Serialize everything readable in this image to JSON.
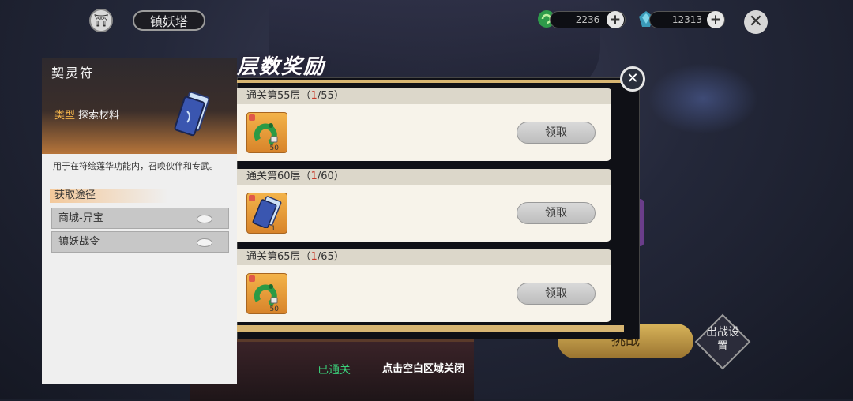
{
  "topbar": {
    "title": "镇妖塔",
    "resources": [
      {
        "name": "jade",
        "icon": "green-dragon-icon",
        "value": "2236"
      },
      {
        "name": "crystal",
        "icon": "blue-crystal-icon",
        "value": "12313"
      }
    ],
    "plus_label": "+",
    "close_label": "✕"
  },
  "info_panel": {
    "title": "契灵符",
    "type_key": "类型",
    "type_value": "探索材料",
    "description": "用于在符绘莲华功能内，召唤伙伴和专武。",
    "sources_title": "获取途径",
    "sources": [
      {
        "label": "商城-异宝"
      },
      {
        "label": "镇妖战令"
      }
    ]
  },
  "reward_panel": {
    "header": "层数奖励",
    "close_label": "✕",
    "rows": [
      {
        "prefix": "通关第55层（",
        "progress": "1",
        "suffix": "/55）",
        "item_icon": "green-dragon-icon",
        "count": "50",
        "claim_label": "领取"
      },
      {
        "prefix": "通关第60层（",
        "progress": "1",
        "suffix": "/60）",
        "item_icon": "talisman-card-icon",
        "count": "1",
        "claim_label": "领取"
      },
      {
        "prefix": "通关第65层（",
        "progress": "1",
        "suffix": "/65）",
        "item_icon": "green-dragon-icon",
        "count": "50",
        "claim_label": "领取"
      }
    ]
  },
  "bottom": {
    "challenge_label": "挑战",
    "battle_settings_label": "出战设置",
    "cleared_label": "已通关",
    "hint": "点击空白区域关闭"
  },
  "colors": {
    "accent_gold": "#d7b572",
    "progress_red": "#c83a2a",
    "cleared_green": "#3ad17a"
  }
}
